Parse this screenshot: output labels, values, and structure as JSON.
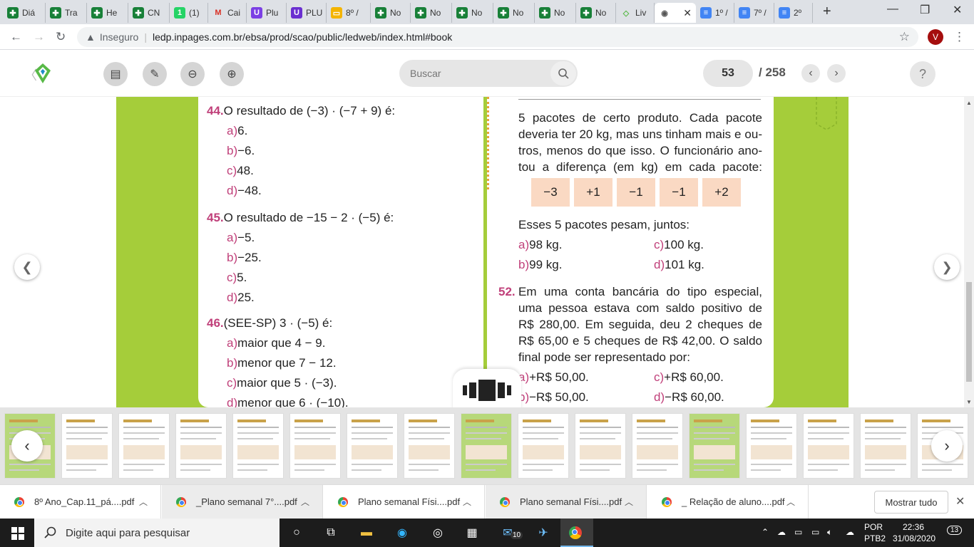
{
  "browser": {
    "tabs": [
      {
        "label": "Diá",
        "icon": "sheets-icon",
        "color": "#188038",
        "glyph": "✚"
      },
      {
        "label": "Tra",
        "icon": "sheets-icon",
        "color": "#188038",
        "glyph": "✚"
      },
      {
        "label": "He",
        "icon": "sheets-icon",
        "color": "#188038",
        "glyph": "✚"
      },
      {
        "label": "CN",
        "icon": "sheets-icon",
        "color": "#188038",
        "glyph": "✚"
      },
      {
        "label": "(1)",
        "icon": "whatsapp-icon",
        "color": "#25d366",
        "glyph": "1"
      },
      {
        "label": "Cai",
        "icon": "gmail-icon",
        "color": "#ffffff",
        "glyph": "M"
      },
      {
        "label": "Plu",
        "icon": "plurall-icon",
        "color": "#7b3fe4",
        "glyph": "U"
      },
      {
        "label": "PLU",
        "icon": "plurall-icon",
        "color": "#6a2fd0",
        "glyph": "U"
      },
      {
        "label": "8º /",
        "icon": "slides-icon",
        "color": "#f4b400",
        "glyph": "▭"
      },
      {
        "label": "No",
        "icon": "sheets-icon",
        "color": "#188038",
        "glyph": "✚"
      },
      {
        "label": "No",
        "icon": "sheets-icon",
        "color": "#188038",
        "glyph": "✚"
      },
      {
        "label": "No",
        "icon": "sheets-icon",
        "color": "#188038",
        "glyph": "✚"
      },
      {
        "label": "No",
        "icon": "sheets-icon",
        "color": "#188038",
        "glyph": "✚"
      },
      {
        "label": "No",
        "icon": "sheets-icon",
        "color": "#188038",
        "glyph": "✚"
      },
      {
        "label": "No",
        "icon": "sheets-icon",
        "color": "#188038",
        "glyph": "✚"
      },
      {
        "label": "Liv",
        "icon": "ledweb-icon",
        "color": "#ffffff",
        "glyph": "◇"
      },
      {
        "label": "",
        "icon": "globe-icon",
        "color": "#ffffff",
        "glyph": "◉",
        "active": true
      },
      {
        "label": "1º /",
        "icon": "docs-icon",
        "color": "#4285f4",
        "glyph": "≡"
      },
      {
        "label": "7º /",
        "icon": "docs-icon",
        "color": "#4285f4",
        "glyph": "≡"
      },
      {
        "label": "2º",
        "icon": "docs-icon",
        "color": "#4285f4",
        "glyph": "≡"
      }
    ],
    "insecure_label": "Inseguro",
    "url": "ledp.inpages.com.br/ebsa/prod/scao/public/ledweb/index.html#book",
    "avatar_letter": "V"
  },
  "reader": {
    "search_placeholder": "Buscar",
    "page_current": "53",
    "page_total": "/ 258"
  },
  "book": {
    "q44": {
      "num": "44.",
      "text": "O resultado de (−3) · (−7 + 9) é:",
      "options": [
        {
          "l": "a)",
          "t": "6."
        },
        {
          "l": "b)",
          "t": "−6."
        },
        {
          "l": "c)",
          "t": "48."
        },
        {
          "l": "d)",
          "t": "−48."
        }
      ]
    },
    "q45": {
      "num": "45.",
      "text": "O resultado de −15 − 2 · (−5) é:",
      "options": [
        {
          "l": "a)",
          "t": "−5."
        },
        {
          "l": "b)",
          "t": "−25."
        },
        {
          "l": "c)",
          "t": "5."
        },
        {
          "l": "d)",
          "t": "25."
        }
      ]
    },
    "q46": {
      "num": "46.",
      "text": "(SEE-SP) 3 · (−5) é:",
      "options": [
        {
          "l": "a)",
          "t": "maior que 4 − 9."
        },
        {
          "l": "b)",
          "t": "menor que 7 − 12."
        },
        {
          "l": "c)",
          "t": "maior que 5 · (−3)."
        },
        {
          "l": "d)",
          "t": "menor que 6 · (−10)."
        }
      ]
    },
    "q51": {
      "lines": [
        "5 pacotes de certo produto. Cada pacote",
        "deveria ter 20 kg, mas uns tinham mais e ou-",
        "tros, menos do que isso. O funcionário ano-",
        "tou a diferença (em kg) em cada pacote:"
      ],
      "diffs": [
        "−3",
        "+1",
        "−1",
        "−1",
        "+2"
      ],
      "question": "Esses 5 pacotes pesam, juntos:",
      "options": [
        {
          "l": "a)",
          "t": "98 kg."
        },
        {
          "l": "b)",
          "t": "99 kg."
        },
        {
          "l": "c)",
          "t": "100 kg."
        },
        {
          "l": "d)",
          "t": "101 kg."
        }
      ]
    },
    "q52": {
      "num": "52.",
      "lines": [
        "Em uma conta bancária do tipo especial,",
        "uma pessoa estava com saldo positivo de",
        "R$ 280,00. Em seguida, deu 2 cheques de",
        "R$ 65,00 e 5 cheques de R$ 42,00. O saldo",
        "final pode ser representado por:"
      ],
      "options": [
        {
          "l": "a)",
          "t": "+R$ 50,00."
        },
        {
          "l": "b)",
          "t": "−R$ 50,00."
        },
        {
          "l": "c)",
          "t": "+R$ 60,00."
        },
        {
          "l": "d)",
          "t": "−R$ 60,00."
        }
      ]
    }
  },
  "downloads": {
    "items": [
      "8º Ano_Cap.11_pá....pdf",
      "_Plano semanal 7°....pdf",
      "Plano semanal Físi....pdf",
      "Plano semanal Físi....pdf",
      "_ Relação de aluno....pdf"
    ],
    "show_all": "Mostrar tudo"
  },
  "taskbar": {
    "search_placeholder": "Digite aqui para pesquisar",
    "mail_badge": "10",
    "lang_top": "POR",
    "lang_bottom": "PTB2",
    "time": "22:36",
    "date": "31/08/2020",
    "notif_count": "13"
  }
}
